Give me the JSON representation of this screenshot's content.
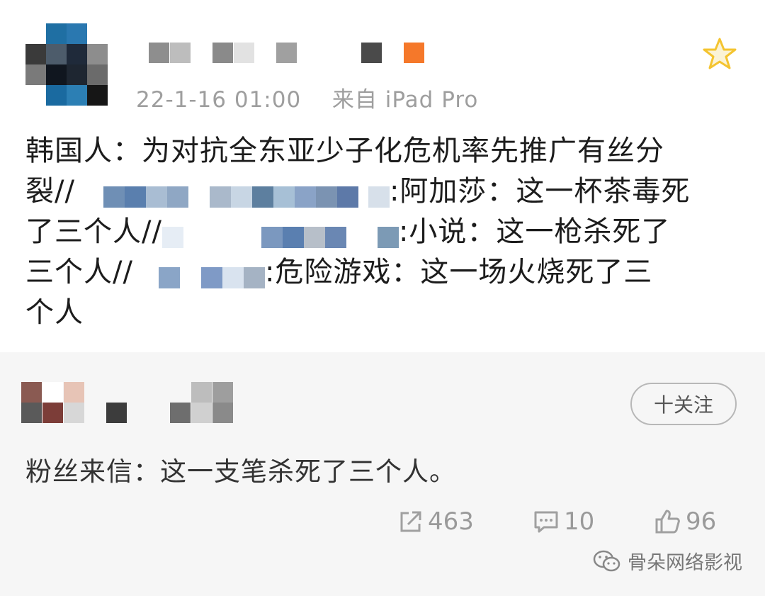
{
  "post": {
    "timestamp": "22-1-16 01:00",
    "source": "来自 iPad Pro",
    "lines": [
      "韩国人：为对抗全东亚少子化危机率先推广有丝分",
      "裂//",
      ":阿加莎：这一杯茶毒死",
      "了三个人//",
      ":小说：这一枪杀死了",
      "三个人//",
      ":危险游戏：这一场火烧死了三",
      "个人"
    ]
  },
  "repost": {
    "follow_label": "十关注",
    "text": "粉丝来信：这一支笔杀死了三个人。",
    "share_count": "463",
    "comment_count": "10",
    "like_count": "96"
  },
  "watermark": {
    "text": "骨朵网络影视"
  },
  "colors": {
    "text": "#1c1c1c",
    "meta": "#9e9e9e",
    "repost_bg": "#f6f6f6",
    "star": "#f4c430",
    "orange_tag": "#f5782a",
    "blur_blue": "#6f8fb5"
  },
  "icons": [
    "star-icon",
    "share-icon",
    "comment-icon",
    "like-icon",
    "wechat-icon"
  ]
}
